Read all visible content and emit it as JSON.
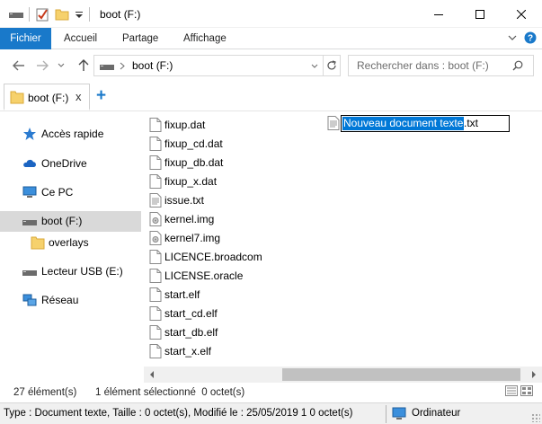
{
  "window": {
    "title": "boot (F:)",
    "minimize": "—",
    "maximize": "☐",
    "close": "✕"
  },
  "ribbon": {
    "tabs": [
      "Fichier",
      "Accueil",
      "Partage",
      "Affichage"
    ],
    "expand_icon": "chevron-down-icon",
    "help_icon": "help-icon"
  },
  "address": {
    "path": "boot (F:)",
    "search_placeholder": "Rechercher dans : boot (F:)"
  },
  "tabbar": {
    "active_tab": "boot (F:)",
    "close": "x",
    "add": "+"
  },
  "nav_pane": {
    "items": [
      {
        "label": "Accès rapide",
        "icon": "star-icon"
      },
      {
        "label": "OneDrive",
        "icon": "cloud-icon"
      },
      {
        "label": "Ce PC",
        "icon": "computer-icon"
      },
      {
        "label": "boot (F:)",
        "icon": "drive-icon",
        "selected": true
      },
      {
        "label": "overlays",
        "icon": "folder-icon"
      },
      {
        "label": "Lecteur USB (E:)",
        "icon": "drive-icon"
      },
      {
        "label": "Réseau",
        "icon": "network-icon"
      }
    ]
  },
  "files": [
    {
      "name": "fixup.dat",
      "icon": "file-icon"
    },
    {
      "name": "fixup_cd.dat",
      "icon": "file-icon"
    },
    {
      "name": "fixup_db.dat",
      "icon": "file-icon"
    },
    {
      "name": "fixup_x.dat",
      "icon": "file-icon"
    },
    {
      "name": "issue.txt",
      "icon": "text-file-icon"
    },
    {
      "name": "kernel.img",
      "icon": "image-file-icon"
    },
    {
      "name": "kernel7.img",
      "icon": "image-file-icon"
    },
    {
      "name": "LICENCE.broadcom",
      "icon": "file-icon"
    },
    {
      "name": "LICENSE.oracle",
      "icon": "file-icon"
    },
    {
      "name": "start.elf",
      "icon": "file-icon"
    },
    {
      "name": "start_cd.elf",
      "icon": "file-icon"
    },
    {
      "name": "start_db.elf",
      "icon": "file-icon"
    },
    {
      "name": "start_x.elf",
      "icon": "file-icon"
    }
  ],
  "rename": {
    "selected_text": "Nouveau document texte",
    "extension": ".txt"
  },
  "status": {
    "count": "27 élément(s)",
    "selection": "1 élément sélectionné  0 octet(s)",
    "details": "Type : Document texte, Taille : 0 octet(s), Modifié le : 25/05/2019 1 0 octet(s)",
    "computer": "Ordinateur"
  },
  "colors": {
    "accent": "#1979ca",
    "selection": "#0078d7",
    "nav_selected": "#d9d9d9"
  }
}
